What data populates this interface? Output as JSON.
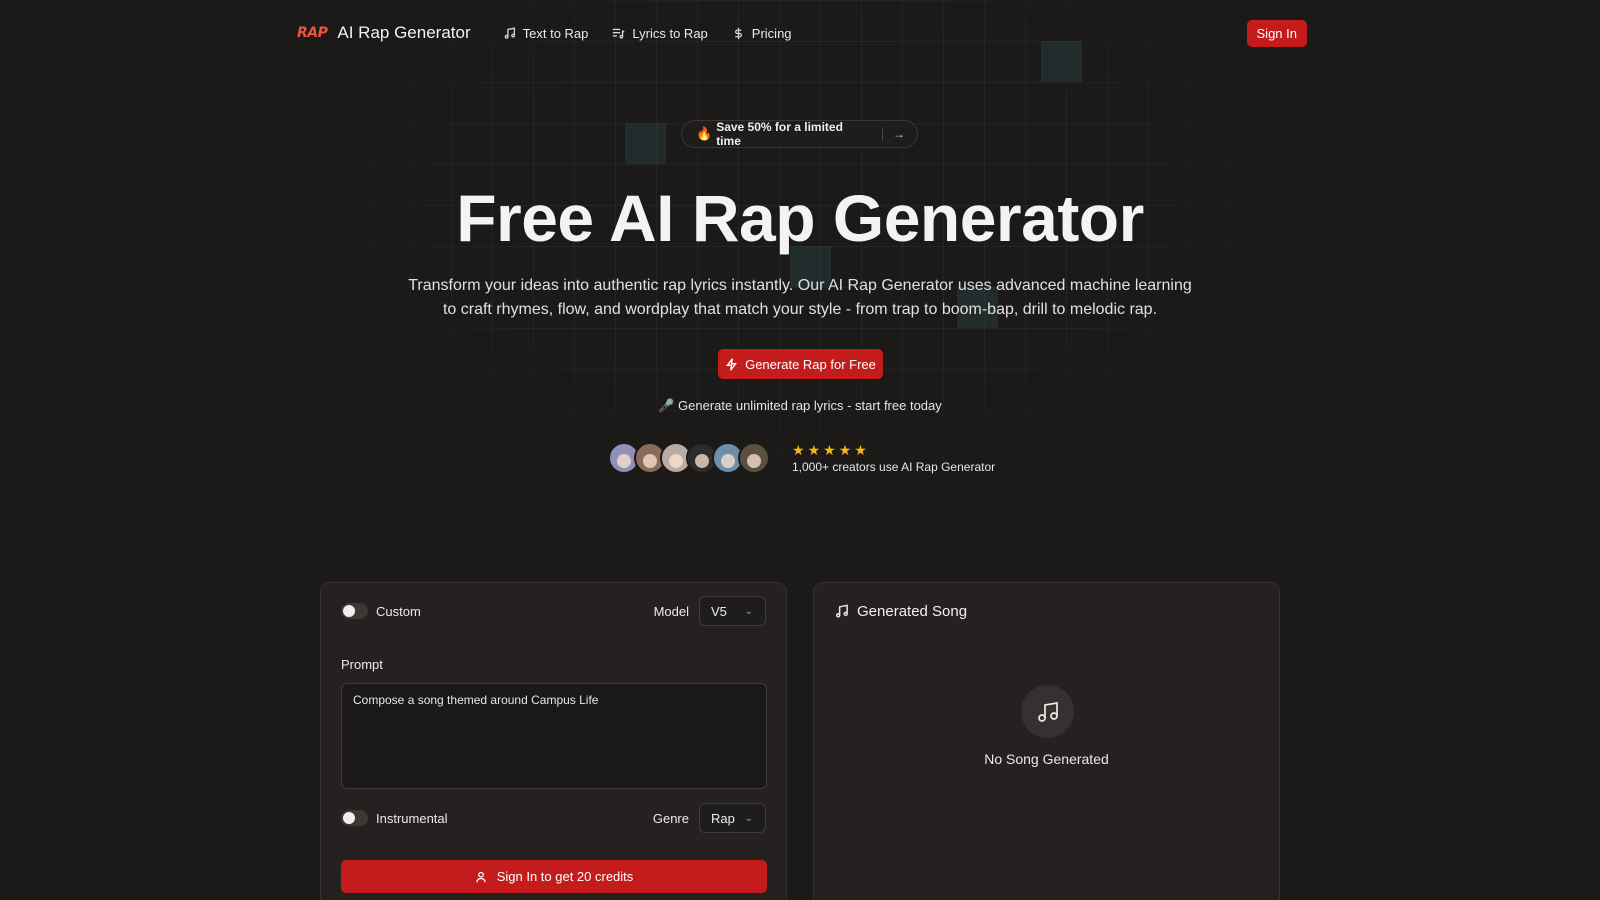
{
  "nav": {
    "logo_text": "RAP",
    "brand": "AI Rap Generator",
    "links": [
      {
        "label": "Text to Rap",
        "icon": "music-note-icon"
      },
      {
        "label": "Lyrics to Rap",
        "icon": "list-music-icon"
      },
      {
        "label": "Pricing",
        "icon": "dollar-icon"
      }
    ],
    "sign_in": "Sign In"
  },
  "promo": {
    "emoji": "🔥",
    "text": "Save 50% for a limited time",
    "arrow": "→"
  },
  "hero": {
    "title": "Free AI Rap Generator",
    "subtitle": "Transform your ideas into authentic rap lyrics instantly. Our AI Rap Generator uses advanced machine learning to craft rhymes, flow, and wordplay that match your style - from trap to boom-bap, drill to melodic rap.",
    "cta": "Generate Rap for Free",
    "tagline": "🎤 Generate unlimited rap lyrics - start free today"
  },
  "social_proof": {
    "rating": 5,
    "stars": [
      "★",
      "★",
      "★",
      "★",
      "★"
    ],
    "text": "1,000+ creators use AI Rap Generator",
    "avatar_colors": [
      "#8f8fb8",
      "#8a6a58",
      "#b8aca4",
      "#2c2c2c",
      "#6f8fa8",
      "#5a5040"
    ]
  },
  "form": {
    "custom_label": "Custom",
    "model_label": "Model",
    "model_value": "V5",
    "prompt_label": "Prompt",
    "prompt_value": "Compose a song themed around Campus Life",
    "instrumental_label": "Instrumental",
    "genre_label": "Genre",
    "genre_value": "Rap",
    "submit": "Sign In to get 20 credits"
  },
  "output": {
    "title": "Generated Song",
    "empty_text": "No Song Generated"
  },
  "colors": {
    "accent": "#c41c1c",
    "background": "#1c1a19",
    "star": "#f5b814"
  }
}
